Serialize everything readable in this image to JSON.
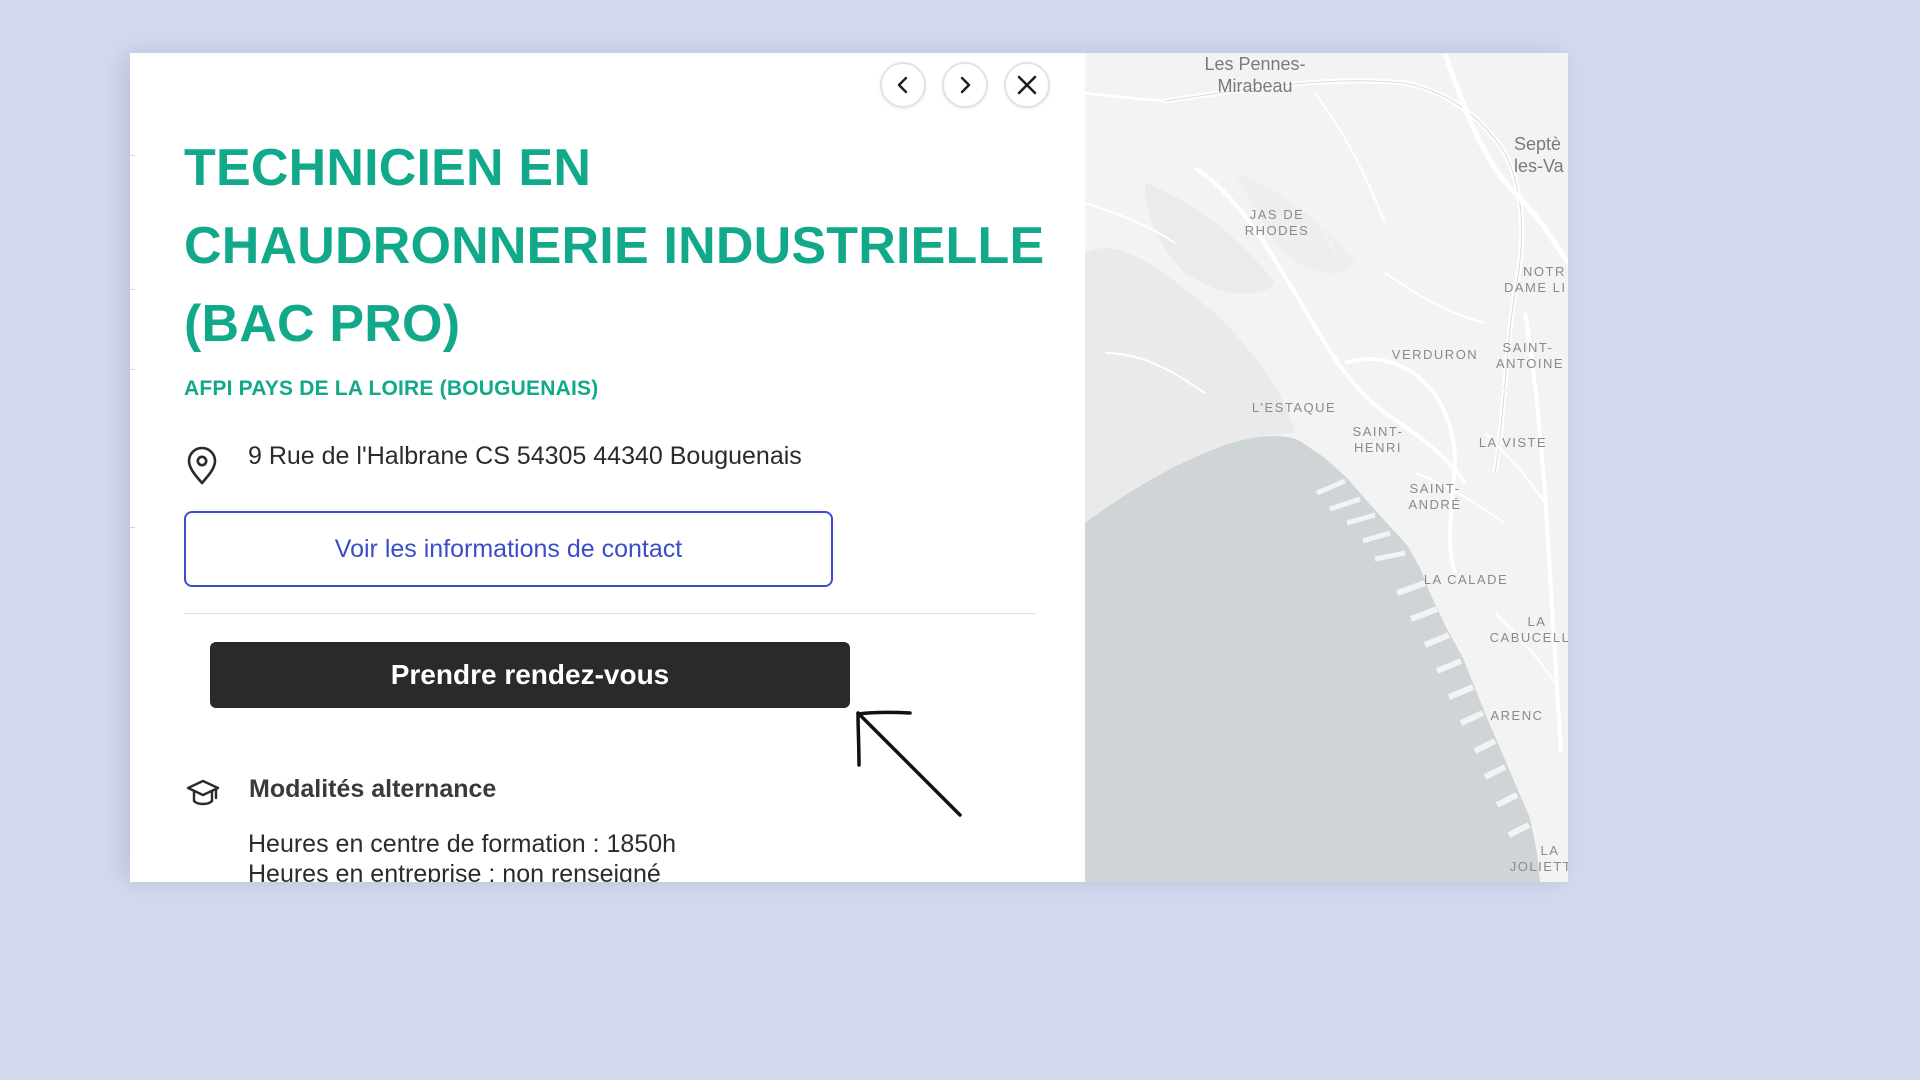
{
  "colors": {
    "accent_green": "#12a98a",
    "link_blue": "#3b4dc8",
    "primary_dark": "#2a2a2a",
    "background": "#d4daee",
    "map_water": "#cfd4d7"
  },
  "nav": {
    "prev_icon": "chevron-left-icon",
    "next_icon": "chevron-right-icon",
    "close_icon": "close-icon"
  },
  "detail": {
    "title_lines": [
      "TECHNICIEN EN",
      "CHAUDRONNERIE INDUSTRIELLE",
      "(BAC PRO)"
    ],
    "organization": "AFPI PAYS DE LA LOIRE (BOUGUENAIS)",
    "address_icon": "map-pin-icon",
    "address": "9 Rue de l'Halbrane CS 54305 44340 Bouguenais",
    "contact_button": "Voir les informations de contact",
    "appointment_button": "Prendre rendez-vous",
    "alternance": {
      "icon": "graduation-cap-icon",
      "title": "Modalités alternance",
      "lines": [
        "Heures en centre de formation : 1850h",
        "Heures en entreprise : non renseigné"
      ]
    }
  },
  "map": {
    "labels": [
      {
        "line1": "Les Pennes-",
        "line2": "Mirabeau"
      },
      {
        "line1": "Septè",
        "line2": "les-Va"
      },
      {
        "line1": "JAS DE",
        "line2": "RHODES"
      },
      {
        "line1": "NOTR",
        "line2": "DAME LI"
      },
      {
        "line1": "VERDURON",
        "line2": ""
      },
      {
        "line1": "SAINT-",
        "line2": "ANTOINE"
      },
      {
        "line1": "L'ESTAQUE",
        "line2": ""
      },
      {
        "line1": "SAINT-",
        "line2": "HENRI"
      },
      {
        "line1": "LA VISTE",
        "line2": ""
      },
      {
        "line1": "SAINT-",
        "line2": "ANDRÉ"
      },
      {
        "line1": "LA CALADE",
        "line2": ""
      },
      {
        "line1": "LA",
        "line2": "CABUCELL"
      },
      {
        "line1": "ARENC",
        "line2": ""
      },
      {
        "line1": "LA",
        "line2": "JOLIETT"
      }
    ]
  }
}
